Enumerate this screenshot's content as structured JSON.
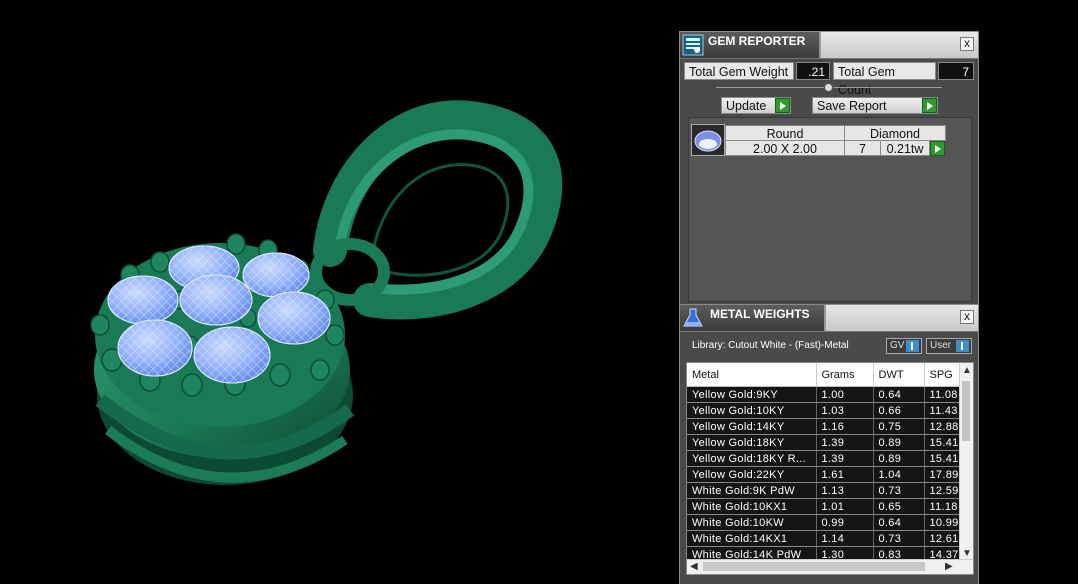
{
  "gem_reporter": {
    "title": "GEM REPORTER",
    "close": "x",
    "total_weight_label": "Total Gem Weight",
    "total_weight_value": ".21",
    "total_count_label": "Total Gem Count",
    "total_count_value": "7",
    "update_label": "Update",
    "save_report_label": "Save Report",
    "gem_row": {
      "shape": "Round",
      "type": "Diamond",
      "size": "2.00 X 2.00",
      "count": "7",
      "weight": "0.21tw"
    }
  },
  "metal_weights": {
    "title": "METAL WEIGHTS",
    "close": "x",
    "library": "Library: Cutout White - (Fast)-Metal",
    "toggle_gv": "GV",
    "toggle_user": "User",
    "columns": [
      "Metal",
      "Grams",
      "DWT",
      "SPG"
    ],
    "rows": [
      [
        "Yellow Gold:9KY",
        "1.00",
        "0.64",
        "11.08"
      ],
      [
        "Yellow Gold:10KY",
        "1.03",
        "0.66",
        "11.43"
      ],
      [
        "Yellow Gold:14KY",
        "1.16",
        "0.75",
        "12.88"
      ],
      [
        "Yellow Gold:18KY",
        "1.39",
        "0.89",
        "15.41"
      ],
      [
        "Yellow Gold:18KY R...",
        "1.39",
        "0.89",
        "15.41"
      ],
      [
        "Yellow Gold:22KY",
        "1.61",
        "1.04",
        "17.89"
      ],
      [
        "White Gold:9K PdW",
        "1.13",
        "0.73",
        "12.59"
      ],
      [
        "White Gold:10KX1",
        "1.01",
        "0.65",
        "11.18"
      ],
      [
        "White Gold:10KW",
        "0.99",
        "0.64",
        "10.99"
      ],
      [
        "White Gold:14KX1",
        "1.14",
        "0.73",
        "12.61"
      ],
      [
        "White Gold:14K PdW",
        "1.30",
        "0.83",
        "14.37"
      ]
    ]
  }
}
